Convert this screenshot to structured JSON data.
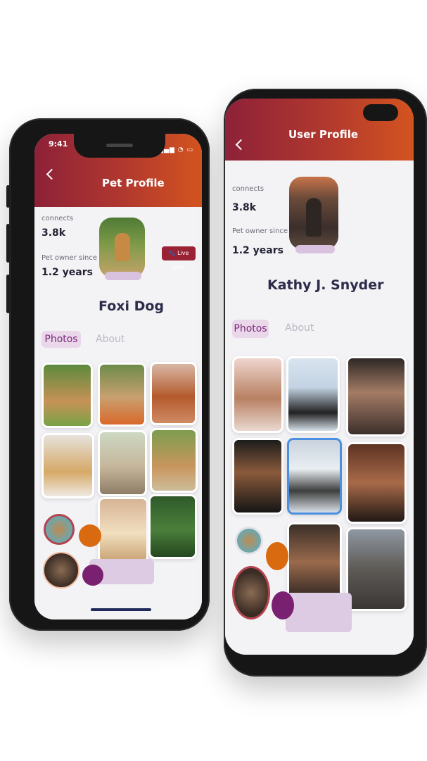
{
  "left_phone": {
    "status_time": "9:41",
    "header_title": "Pet Profile",
    "connects_label": "connects",
    "connects_value": "3.8k",
    "owner_label": "Pet owner since",
    "owner_value": "1.2 years",
    "live_walk_label": "Live walk",
    "profile_name": "Foxi Dog",
    "tabs": [
      "Photos",
      "About"
    ]
  },
  "right_phone": {
    "header_title": "User Profile",
    "connects_label": "connects",
    "connects_value": "3.8k",
    "owner_label": "Pet owner since",
    "owner_value": "1.2 years",
    "profile_name": "Kathy J. Snyder",
    "tabs": [
      "Photos",
      "About"
    ]
  },
  "colors": {
    "header_gradient_start": "#8d2138",
    "header_gradient_end": "#d3541f",
    "active_tab_bg": "#ead7ea",
    "orange_dot": "#d96a10",
    "purple_dot": "#7a2070"
  }
}
